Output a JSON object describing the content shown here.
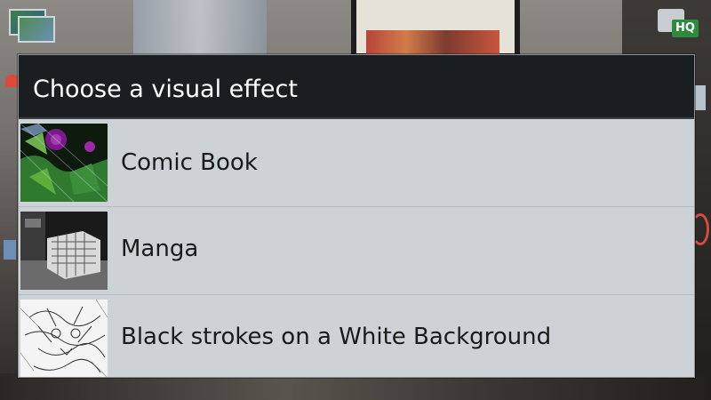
{
  "dialog": {
    "title": "Choose a visual effect",
    "items": [
      {
        "label": "Comic Book",
        "thumbnail_icon": "comic-book-thumbnail"
      },
      {
        "label": "Manga",
        "thumbnail_icon": "manga-thumbnail"
      },
      {
        "label": "Black strokes on a White Background",
        "thumbnail_icon": "black-strokes-thumbnail"
      }
    ]
  },
  "camera_controls": {
    "left_top_icon": "gallery-icon",
    "right_top_icon": "hq-camera-icon"
  },
  "colors": {
    "dialog_title_bg": "#1b1e21",
    "dialog_body_bg": "#cdd2d6",
    "title_text": "#ffffff",
    "item_text": "#1a1a1a"
  }
}
